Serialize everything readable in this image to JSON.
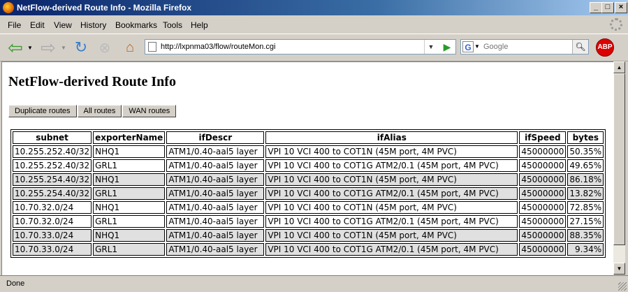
{
  "window": {
    "title": "NetFlow-derived Route Info - Mozilla Firefox",
    "controls": [
      "_",
      "□",
      "×"
    ]
  },
  "menu": [
    "File",
    "Edit",
    "View",
    "History",
    "Bookmarks",
    "Tools",
    "Help"
  ],
  "toolbar": {
    "url": "http://lxpnma03/flow/routeMon.cgi",
    "search_placeholder": "Google",
    "abp_label": "ABP"
  },
  "page": {
    "heading": "NetFlow-derived Route Info",
    "buttons": [
      "Duplicate routes",
      "All routes",
      "WAN routes"
    ],
    "columns": [
      "subnet",
      "exporterName",
      "ifDescr",
      "ifAlias",
      "ifSpeed",
      "bytes"
    ],
    "rows": [
      {
        "subnet": "10.255.252.40/32",
        "exporter": "NHQ1",
        "ifDescr": "ATM1/0.40-aal5 layer",
        "ifAlias": "VPI 10 VCI 400 to COT1N (45M port, 4M PVC)",
        "ifSpeed": "45000000",
        "bytes": "50.35%",
        "alt": false
      },
      {
        "subnet": "10.255.252.40/32",
        "exporter": "GRL1",
        "ifDescr": "ATM1/0.40-aal5 layer",
        "ifAlias": "VPI 10 VCI 400 to COT1G ATM2/0.1 (45M port, 4M PVC)",
        "ifSpeed": "45000000",
        "bytes": "49.65%",
        "alt": false
      },
      {
        "subnet": "10.255.254.40/32",
        "exporter": "NHQ1",
        "ifDescr": "ATM1/0.40-aal5 layer",
        "ifAlias": "VPI 10 VCI 400 to COT1N (45M port, 4M PVC)",
        "ifSpeed": "45000000",
        "bytes": "86.18%",
        "alt": true
      },
      {
        "subnet": "10.255.254.40/32",
        "exporter": "GRL1",
        "ifDescr": "ATM1/0.40-aal5 layer",
        "ifAlias": "VPI 10 VCI 400 to COT1G ATM2/0.1 (45M port, 4M PVC)",
        "ifSpeed": "45000000",
        "bytes": "13.82%",
        "alt": true
      },
      {
        "subnet": "10.70.32.0/24",
        "exporter": "NHQ1",
        "ifDescr": "ATM1/0.40-aal5 layer",
        "ifAlias": "VPI 10 VCI 400 to COT1N (45M port, 4M PVC)",
        "ifSpeed": "45000000",
        "bytes": "72.85%",
        "alt": false
      },
      {
        "subnet": "10.70.32.0/24",
        "exporter": "GRL1",
        "ifDescr": "ATM1/0.40-aal5 layer",
        "ifAlias": "VPI 10 VCI 400 to COT1G ATM2/0.1 (45M port, 4M PVC)",
        "ifSpeed": "45000000",
        "bytes": "27.15%",
        "alt": false
      },
      {
        "subnet": "10.70.33.0/24",
        "exporter": "NHQ1",
        "ifDescr": "ATM1/0.40-aal5 layer",
        "ifAlias": "VPI 10 VCI 400 to COT1N (45M port, 4M PVC)",
        "ifSpeed": "45000000",
        "bytes": "88.35%",
        "alt": true
      },
      {
        "subnet": "10.70.33.0/24",
        "exporter": "GRL1",
        "ifDescr": "ATM1/0.40-aal5 layer",
        "ifAlias": "VPI 10 VCI 400 to COT1G ATM2/0.1 (45M port, 4M PVC)",
        "ifSpeed": "45000000",
        "bytes": "9.34%",
        "alt": true
      }
    ]
  },
  "status": {
    "text": "Done"
  }
}
